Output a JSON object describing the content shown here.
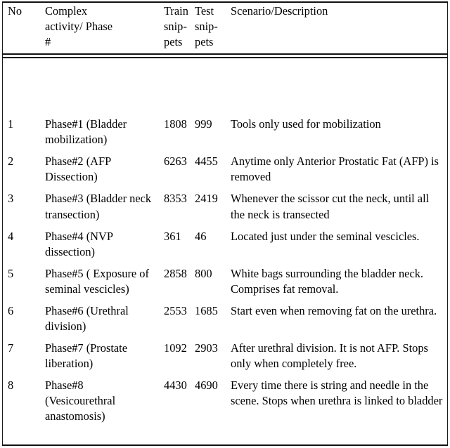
{
  "table": {
    "caption_rules": {
      "top_rule": true,
      "header_double_rule": true,
      "bottom_rule": true
    },
    "columns": [
      {
        "key": "no",
        "header_lines": [
          "No",
          "",
          ""
        ]
      },
      {
        "key": "activity",
        "header_lines": [
          "Complex",
          "activity/ Phase",
          "#"
        ]
      },
      {
        "key": "train",
        "header_lines": [
          "Train",
          "snip-",
          "pets"
        ]
      },
      {
        "key": "test",
        "header_lines": [
          "Test",
          "snip-",
          "pets"
        ]
      },
      {
        "key": "desc",
        "header_lines": [
          "Scenario/Description",
          "",
          ""
        ]
      }
    ],
    "header": {
      "no": "No",
      "activity_l1": "Complex",
      "activity_l2": "activity/ Phase",
      "activity_l3": "#",
      "train_l1": "Train",
      "train_l2": "snip-",
      "train_l3": "pets",
      "test_l1": "Test",
      "test_l2": "snip-",
      "test_l3": "pets",
      "desc": "Scenario/Description"
    },
    "rows": [
      {
        "no": "1",
        "activity": "Phase#1 (Bladder mobilization)",
        "train": "1808",
        "test": "999",
        "desc": "Tools only used for mobilization"
      },
      {
        "no": "2",
        "activity": "Phase#2 (AFP Dissection)",
        "train": "6263",
        "test": "4455",
        "desc": "Anytime only Anterior Prostatic Fat (AFP) is removed"
      },
      {
        "no": "3",
        "activity": "Phase#3 (Bladder neck transection)",
        "train": "8353",
        "test": "2419",
        "desc": "Whenever the scissor cut the neck, until all the neck is transected"
      },
      {
        "no": "4",
        "activity": "Phase#4 (NVP dissection)",
        "train": "361",
        "test": "46",
        "desc": "Located just under the seminal vescicles."
      },
      {
        "no": "5",
        "activity": "Phase#5 ( Exposure of seminal vescicles)",
        "train": "2858",
        "test": "800",
        "desc": "White bags surrounding the bladder neck. Comprises fat removal."
      },
      {
        "no": "6",
        "activity": "Phase#6 (Urethral division)",
        "train": "2553",
        "test": "1685",
        "desc": "Start even when removing fat on the urethra."
      },
      {
        "no": "7",
        "activity": "Phase#7 (Prostate liberation)",
        "train": "1092",
        "test": "2903",
        "desc": "After urethral division. It is not AFP. Stops only when completely free."
      },
      {
        "no": "8",
        "activity": "Phase#8 (Vesicourethral anastomosis)",
        "train": "4430",
        "test": "4690",
        "desc": "Every time there is string and needle in the scene. Stops when urethra is linked to bladder"
      }
    ]
  },
  "colors": {
    "page_background": "#ffffff",
    "text": "#000000",
    "rule": "#111111"
  }
}
